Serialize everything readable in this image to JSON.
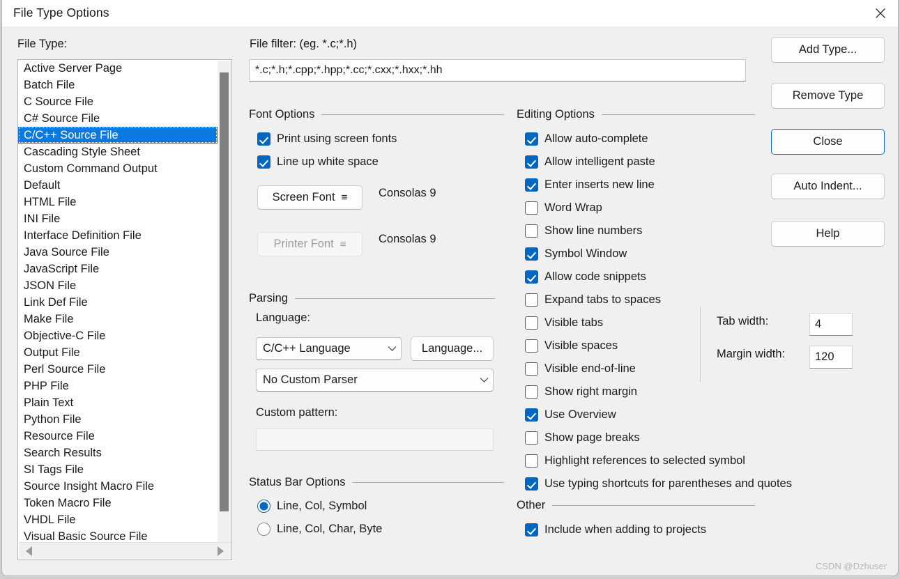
{
  "window": {
    "title": "File Type Options",
    "close_icon": "close-icon"
  },
  "file_type": {
    "label": "File Type:",
    "selected": "C/C++ Source File",
    "items": [
      "Active Server Page",
      "Batch File",
      "C Source File",
      "C# Source File",
      "C/C++ Source File",
      "Cascading Style Sheet",
      "Custom Command Output",
      "Default",
      "HTML File",
      "INI File",
      "Interface Definition File",
      "Java Source File",
      "JavaScript File",
      "JSON File",
      "Link Def File",
      "Make File",
      "Objective-C File",
      "Output File",
      "Perl Source File",
      "PHP File",
      "Plain Text",
      "Python File",
      "Resource File",
      "Search Results",
      "SI Tags File",
      "Source Insight Macro File",
      "Token Macro File",
      "VHDL File",
      "Visual Basic Source File"
    ]
  },
  "file_filter": {
    "label": "File filter: (eg. *.c;*.h)",
    "value": "*.c;*.h;*.cpp;*.hpp;*.cc;*.cxx;*.hxx;*.hh"
  },
  "font_options": {
    "group_title": "Font Options",
    "print_using_screen_fonts": {
      "label": "Print using screen fonts",
      "checked": true
    },
    "line_up_white_space": {
      "label": "Line up white space",
      "checked": true
    },
    "screen_font_button": "Screen Font",
    "screen_font_value": "Consolas 9",
    "printer_font_button": "Printer Font",
    "printer_font_value": "Consolas 9",
    "menu_glyph": "≡"
  },
  "parsing": {
    "group_title": "Parsing",
    "language_label": "Language:",
    "language_value": "C/C++ Language",
    "language_button": "Language...",
    "parser_value": "No Custom Parser",
    "custom_pattern_label": "Custom pattern:",
    "custom_pattern_value": ""
  },
  "status_bar": {
    "group_title": "Status Bar Options",
    "options": [
      {
        "label": "Line, Col, Symbol",
        "selected": true
      },
      {
        "label": "Line, Col, Char, Byte",
        "selected": false
      }
    ]
  },
  "editing_options": {
    "group_title": "Editing Options",
    "items": [
      {
        "label": "Allow auto-complete",
        "checked": true
      },
      {
        "label": "Allow intelligent paste",
        "checked": true
      },
      {
        "label": "Enter inserts new line",
        "checked": true
      },
      {
        "label": "Word Wrap",
        "checked": false
      },
      {
        "label": "Show line numbers",
        "checked": false
      },
      {
        "label": "Symbol Window",
        "checked": true
      },
      {
        "label": "Allow code snippets",
        "checked": true
      },
      {
        "label": "Expand tabs to spaces",
        "checked": false
      },
      {
        "label": "Visible tabs",
        "checked": false
      },
      {
        "label": "Visible spaces",
        "checked": false
      },
      {
        "label": "Visible end-of-line",
        "checked": false
      },
      {
        "label": "Show right margin",
        "checked": false
      },
      {
        "label": "Use Overview",
        "checked": true
      },
      {
        "label": "Show page breaks",
        "checked": false
      },
      {
        "label": "Highlight references to selected symbol",
        "checked": false
      },
      {
        "label": "Use typing shortcuts for parentheses and quotes",
        "checked": true
      }
    ],
    "tab_width_label": "Tab width:",
    "tab_width_value": "4",
    "margin_width_label": "Margin width:",
    "margin_width_value": "120"
  },
  "other": {
    "group_title": "Other",
    "include_when_adding": {
      "label": "Include when adding to projects",
      "checked": true
    }
  },
  "buttons": {
    "add_type": "Add Type...",
    "remove_type": "Remove Type",
    "close": "Close",
    "auto_indent": "Auto Indent...",
    "help": "Help"
  },
  "watermark": "CSDN @Dzhuser",
  "colors": {
    "accent": "#0067c0",
    "selection": "#0b7ae0",
    "dialog_bg": "#f0f0f0"
  }
}
